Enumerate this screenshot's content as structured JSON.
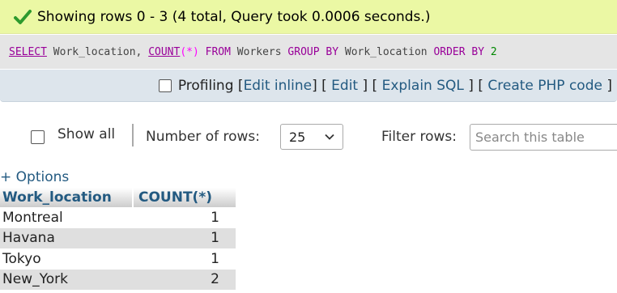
{
  "message": {
    "icon": "success-check-icon",
    "text": "Showing rows 0 - 3 (4 total, Query took 0.0006 seconds.)"
  },
  "sql": {
    "tokens": {
      "select": "SELECT",
      "col": "Work_location,",
      "count": "COUNT",
      "paren_open": "(",
      "star": "*",
      "paren_close": ")",
      "from": "FROM",
      "table": "Workers",
      "group_by": "GROUP BY",
      "group_col": "Work_location",
      "order_by": "ORDER BY",
      "order_num": "2"
    }
  },
  "tools": {
    "profiling": "Profiling",
    "edit_inline": "Edit inline",
    "edit": "Edit",
    "explain": "Explain SQL",
    "create_php": "Create PHP code",
    "bracket_open": "[",
    "bracket_close": "]"
  },
  "nav": {
    "show_all": "Show all",
    "number_of_rows_label": "Number of rows:",
    "rows_value": "25",
    "filter_label": "Filter rows:",
    "filter_placeholder": "Search this table"
  },
  "options_link": "+ Options",
  "table": {
    "columns": [
      "Work_location",
      "COUNT(*)"
    ],
    "rows": [
      [
        "Montreal",
        "1"
      ],
      [
        "Havana",
        "1"
      ],
      [
        "Tokyo",
        "1"
      ],
      [
        "New_York",
        "2"
      ]
    ]
  },
  "colors": {
    "success_bg": "#ebf8a4",
    "link": "#235a81",
    "sql_keyword": "#990099"
  }
}
